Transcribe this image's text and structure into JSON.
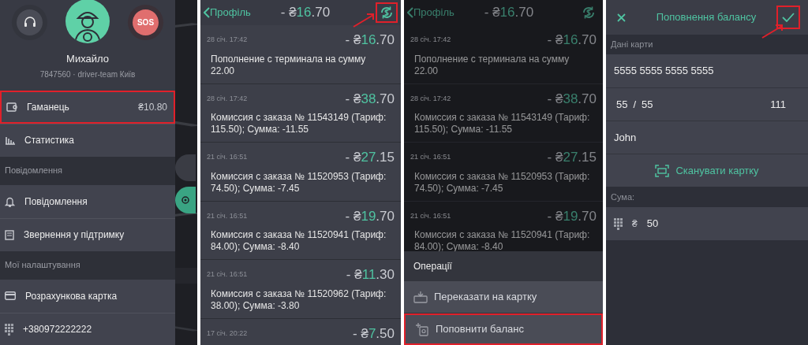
{
  "menu_panel": {
    "sos_button": {
      "label": "SOS"
    },
    "profile": {
      "name": "Михайло",
      "subtitle": "7847560 · driver-team Київ"
    },
    "sections": [
      {
        "items": [
          {
            "kind": "wallet",
            "label": "Гаманець",
            "value": "₴10.80",
            "highlighted": true
          },
          {
            "kind": "stats",
            "label": "Статистика",
            "highlighted": false
          }
        ]
      },
      {
        "header": "Повідомлення",
        "items": [
          {
            "kind": "bell",
            "label": "Повідомлення",
            "highlighted": false
          },
          {
            "kind": "support",
            "label": "Звернення у підтримку",
            "highlighted": false
          }
        ]
      },
      {
        "header": "Мої налаштування",
        "items": [
          {
            "kind": "card",
            "label": "Розрахункова картка",
            "highlighted": false
          },
          {
            "kind": "keypad",
            "label": "+380972222222",
            "highlighted": false
          }
        ]
      }
    ]
  },
  "wallet_panel": {
    "back_label": "Профіль",
    "balance": {
      "prefix": "- ₴",
      "accent": "16",
      "rest": ".70"
    },
    "exchange_button": {
      "highlighted": true
    },
    "entries": [
      {
        "date": "28 січ. 17:42",
        "amount": {
          "prefix": "- ₴",
          "accent": "16",
          "rest": ".70"
        },
        "description": "Пополнение с терминала на сумму 22.00"
      },
      {
        "date": "28 січ. 17:42",
        "amount": {
          "prefix": "- ₴",
          "accent": "38",
          "rest": ".70"
        },
        "description": "Комиссия с заказа № 11543149 (Тариф: 115.50); Сумма: -11.55"
      },
      {
        "date": "21 січ. 16:51",
        "amount": {
          "prefix": "- ₴",
          "accent": "27",
          "rest": ".15"
        },
        "description": "Комиссия с заказа № 11520953 (Тариф: 74.50); Сумма: -7.45"
      },
      {
        "date": "21 січ. 16:51",
        "amount": {
          "prefix": "- ₴",
          "accent": "19",
          "rest": ".70"
        },
        "description": "Комиссия с заказа № 11520941 (Тариф: 84.00); Сумма: -8.40"
      },
      {
        "date": "21 січ. 16:51",
        "amount": {
          "prefix": "- ₴",
          "accent": "11",
          "rest": ".30"
        },
        "description": "Комиссия с заказа № 11520962 (Тариф: 38.00); Сумма: -3.80"
      },
      {
        "date": "17 січ. 20:22",
        "amount": {
          "prefix": "- ₴",
          "accent": "7",
          "rest": ".50"
        }
      }
    ]
  },
  "operations_panel": {
    "back_label": "Профіль",
    "balance": {
      "prefix": "- ₴",
      "accent": "16",
      "rest": ".70"
    },
    "entries": [
      {
        "date": "28 січ. 17:42",
        "amount": {
          "prefix": "- ₴",
          "accent": "16",
          "rest": ".70"
        },
        "description": "Пополнение с терминала на сумму 22.00"
      },
      {
        "date": "28 січ. 17:42",
        "amount": {
          "prefix": "- ₴",
          "accent": "38",
          "rest": ".70"
        },
        "description": "Комиссия с заказа № 11543149 (Тариф: 115.50); Сумма: -11.55"
      },
      {
        "date": "21 січ. 16:51",
        "amount": {
          "prefix": "- ₴",
          "accent": "27",
          "rest": ".15"
        },
        "description": "Комиссия с заказа № 11520953 (Тариф: 74.50); Сумма: -7.45"
      },
      {
        "date": "21 січ. 16:51",
        "amount": {
          "prefix": "- ₴",
          "accent": "19",
          "rest": ".70"
        },
        "description": "Комиссия с заказа № 11520941 (Тариф: 84.00); Сумма: -8.40"
      }
    ],
    "sheet": {
      "title": "Операції",
      "actions": [
        {
          "kind": "withdraw",
          "label": "Переказати на картку",
          "highlighted": false
        },
        {
          "kind": "topup",
          "label": "Поповнити баланс",
          "highlighted": true
        }
      ]
    }
  },
  "topup_panel": {
    "title": "Поповнення балансу",
    "confirm_highlighted": true,
    "card_section": "Дані карти",
    "card_number": "5555 5555 5555 5555",
    "expiry_month": "55",
    "expiry_separator": "/",
    "expiry_year": "55",
    "cvv": "111",
    "holder": "John",
    "scan_label": "Сканувати картку",
    "amount_section": "Сума:",
    "currency": "₴",
    "amount": "50"
  }
}
